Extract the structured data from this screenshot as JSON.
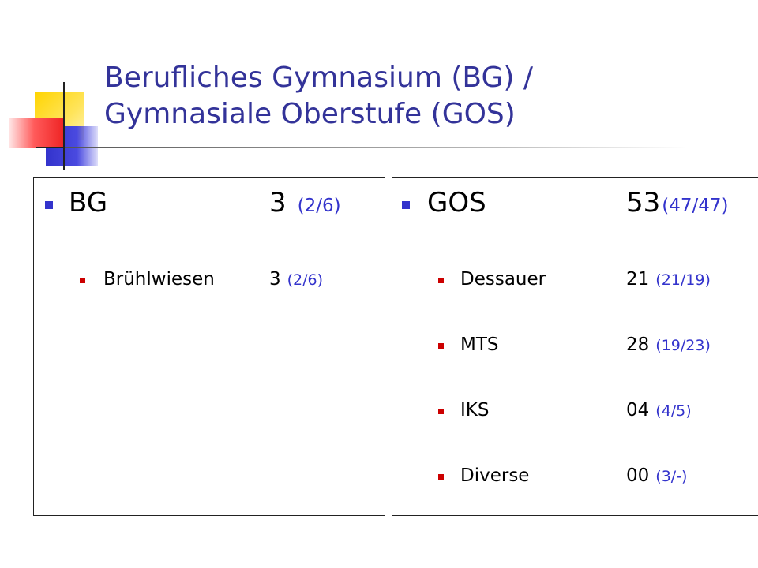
{
  "title": {
    "line1": "Berufliches Gymnasium (BG) /",
    "line2": "Gymnasiale Oberstufe (GOS)"
  },
  "left_panel": {
    "heading": {
      "label": "BG",
      "value": "3",
      "sub": "(2/6)"
    },
    "items": [
      {
        "label": "Brühlwiesen",
        "value": "3",
        "sub": "(2/6)"
      }
    ]
  },
  "right_panel": {
    "heading": {
      "label": "GOS",
      "value": "53",
      "sub": "(47/47)"
    },
    "items": [
      {
        "label": "Dessauer",
        "value": "21",
        "sub": "(21/19)"
      },
      {
        "label": "MTS",
        "value": "28",
        "sub": "(19/23)"
      },
      {
        "label": "IKS",
        "value": "04",
        "sub": "(4/5)"
      },
      {
        "label": "Diverse",
        "value": "00",
        "sub": "(3/-)"
      }
    ]
  },
  "colors": {
    "title": "#333399",
    "accent_blue": "#3333cc",
    "bullet_red": "#cc0000"
  }
}
